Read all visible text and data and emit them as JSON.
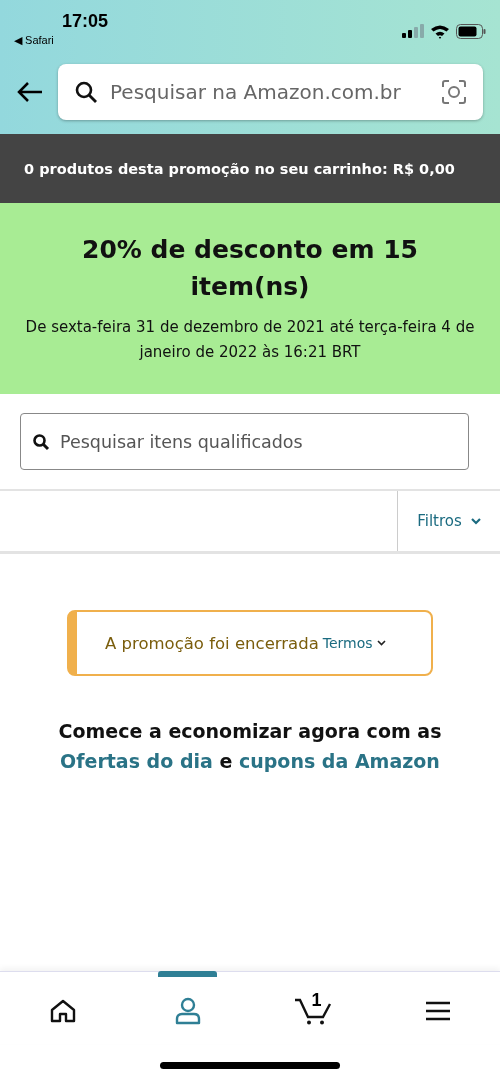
{
  "status_bar": {
    "time": "17:05",
    "back_app": "◀ Safari"
  },
  "header": {
    "search": {
      "placeholder": "Pesquisar na Amazon.com.br"
    }
  },
  "cart_banner": {
    "text": "0 produtos desta promoção no seu carrinho: R$ 0,00"
  },
  "promotion": {
    "title": "20% de desconto em 15 item(ns)",
    "dates": "De sexta-feira 31 de dezembro de 2021 até terça-feira 4 de janeiro de 2022 às 16:21 BRT"
  },
  "item_search": {
    "placeholder": "Pesquisar itens qualificados"
  },
  "filters": {
    "label": "Filtros"
  },
  "notice": {
    "text": "A promoção foi encerrada",
    "terms_link": "Termos"
  },
  "cta": {
    "text": "Comece a economizar agora com as",
    "link_1": "Ofertas do dia",
    "joiner": "e",
    "link_2": "cupons da Amazon"
  },
  "bottom_nav": [
    {
      "kind": "home",
      "selected": false
    },
    {
      "kind": "account",
      "selected": true
    },
    {
      "kind": "cart",
      "selected": false,
      "count": "1"
    },
    {
      "kind": "menu",
      "selected": false
    }
  ]
}
